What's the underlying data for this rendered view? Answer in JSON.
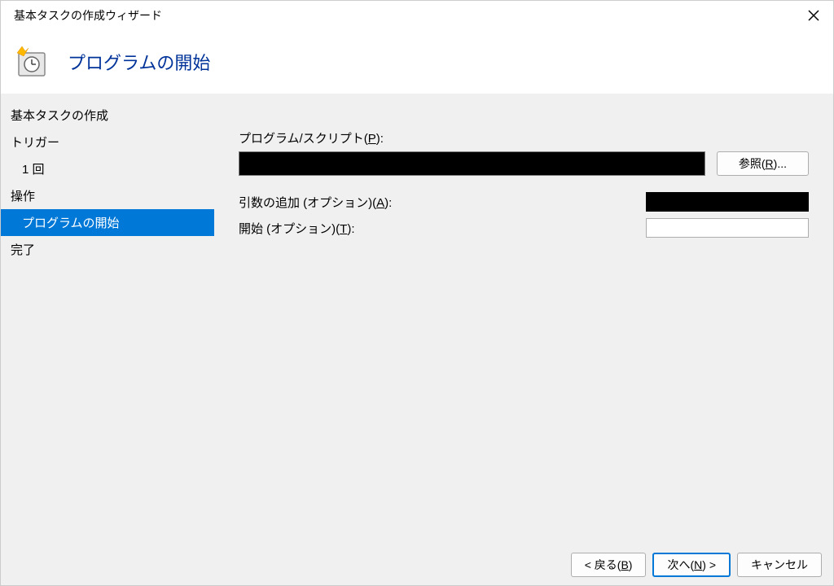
{
  "window": {
    "title": "基本タスクの作成ウィザード"
  },
  "header": {
    "title": "プログラムの開始"
  },
  "sidebar": {
    "items": [
      {
        "label": "基本タスクの作成",
        "indent": false,
        "selected": false
      },
      {
        "label": "トリガー",
        "indent": false,
        "selected": false
      },
      {
        "label": "1 回",
        "indent": true,
        "selected": false
      },
      {
        "label": "操作",
        "indent": false,
        "selected": false
      },
      {
        "label": "プログラムの開始",
        "indent": true,
        "selected": true
      },
      {
        "label": "完了",
        "indent": false,
        "selected": false
      }
    ]
  },
  "form": {
    "program_label_pre": "プログラム/スクリプト(",
    "program_label_key": "P",
    "program_label_post": "):",
    "program_value": "",
    "browse_pre": "参照(",
    "browse_key": "R",
    "browse_post": ")...",
    "args_label_pre": "引数の追加 (オプション)(",
    "args_label_key": "A",
    "args_label_post": "):",
    "args_value": "",
    "startin_label_pre": "開始 (オプション)(",
    "startin_label_key": "T",
    "startin_label_post": "):",
    "startin_value": ""
  },
  "footer": {
    "back_pre": "< 戻る(",
    "back_key": "B",
    "back_post": ")",
    "next_pre": "次へ(",
    "next_key": "N",
    "next_post": ") >",
    "cancel": "キャンセル"
  }
}
